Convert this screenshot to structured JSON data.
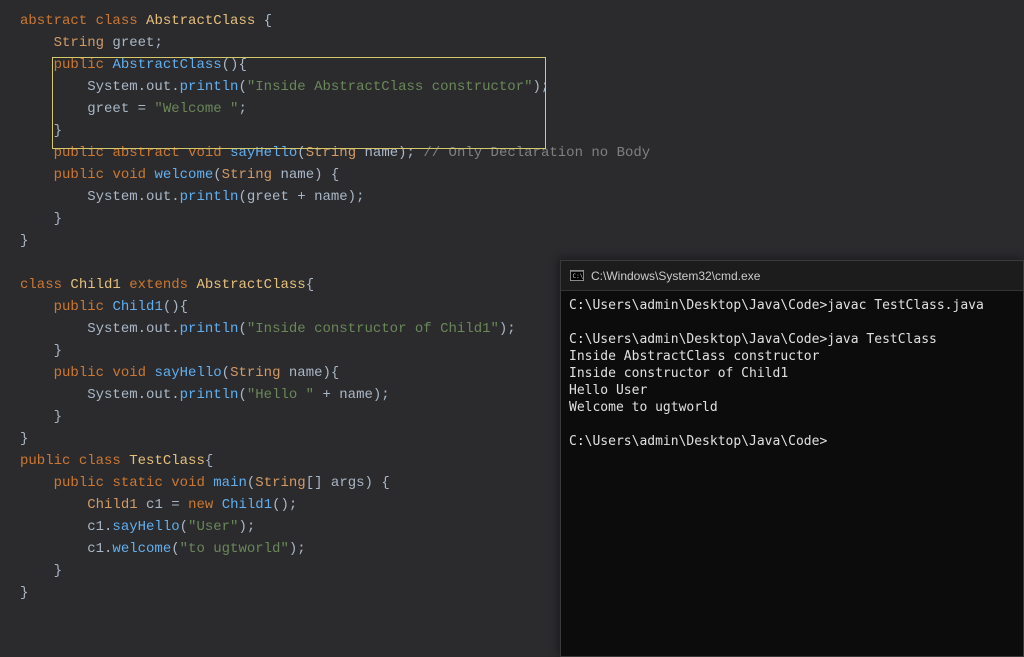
{
  "editor": {
    "tokens": [
      [
        {
          "t": "abstract",
          "c": "kw"
        },
        {
          "t": " ",
          "c": "punc"
        },
        {
          "t": "class",
          "c": "kw"
        },
        {
          "t": " ",
          "c": "punc"
        },
        {
          "t": "AbstractClass",
          "c": "cls"
        },
        {
          "t": " {",
          "c": "punc"
        }
      ],
      [
        {
          "t": "    ",
          "c": "punc"
        },
        {
          "t": "String",
          "c": "type"
        },
        {
          "t": " greet;",
          "c": "punc"
        }
      ],
      [
        {
          "t": "    ",
          "c": "punc"
        },
        {
          "t": "public",
          "c": "kw"
        },
        {
          "t": " ",
          "c": "punc"
        },
        {
          "t": "AbstractClass",
          "c": "fn"
        },
        {
          "t": "(){",
          "c": "punc"
        }
      ],
      [
        {
          "t": "        System.out.",
          "c": "punc"
        },
        {
          "t": "println",
          "c": "fn"
        },
        {
          "t": "(",
          "c": "punc"
        },
        {
          "t": "\"Inside AbstractClass constructor\"",
          "c": "str"
        },
        {
          "t": ");",
          "c": "punc"
        }
      ],
      [
        {
          "t": "        greet = ",
          "c": "punc"
        },
        {
          "t": "\"Welcome \"",
          "c": "str"
        },
        {
          "t": ";",
          "c": "punc"
        }
      ],
      [
        {
          "t": "    }",
          "c": "punc"
        }
      ],
      [
        {
          "t": "    ",
          "c": "punc"
        },
        {
          "t": "public",
          "c": "kw"
        },
        {
          "t": " ",
          "c": "punc"
        },
        {
          "t": "abstract",
          "c": "kw"
        },
        {
          "t": " ",
          "c": "punc"
        },
        {
          "t": "void",
          "c": "kw"
        },
        {
          "t": " ",
          "c": "punc"
        },
        {
          "t": "sayHello",
          "c": "fn"
        },
        {
          "t": "(",
          "c": "punc"
        },
        {
          "t": "String",
          "c": "type"
        },
        {
          "t": " name);",
          "c": "punc"
        },
        {
          "t": " ",
          "c": "punc"
        },
        {
          "t": "// Only Declaration no Body",
          "c": "cmt"
        }
      ],
      [
        {
          "t": "    ",
          "c": "punc"
        },
        {
          "t": "public",
          "c": "kw"
        },
        {
          "t": " ",
          "c": "punc"
        },
        {
          "t": "void",
          "c": "kw"
        },
        {
          "t": " ",
          "c": "punc"
        },
        {
          "t": "welcome",
          "c": "fn"
        },
        {
          "t": "(",
          "c": "punc"
        },
        {
          "t": "String",
          "c": "type"
        },
        {
          "t": " name) {",
          "c": "punc"
        }
      ],
      [
        {
          "t": "        System.out.",
          "c": "punc"
        },
        {
          "t": "println",
          "c": "fn"
        },
        {
          "t": "(greet + name);",
          "c": "punc"
        }
      ],
      [
        {
          "t": "    }",
          "c": "punc"
        }
      ],
      [
        {
          "t": "}",
          "c": "punc"
        }
      ],
      [
        {
          "t": " ",
          "c": "punc"
        }
      ],
      [
        {
          "t": "class",
          "c": "kw"
        },
        {
          "t": " ",
          "c": "punc"
        },
        {
          "t": "Child1",
          "c": "cls"
        },
        {
          "t": " ",
          "c": "punc"
        },
        {
          "t": "extends",
          "c": "kw"
        },
        {
          "t": " ",
          "c": "punc"
        },
        {
          "t": "AbstractClass",
          "c": "cls"
        },
        {
          "t": "{",
          "c": "punc"
        }
      ],
      [
        {
          "t": "    ",
          "c": "punc"
        },
        {
          "t": "public",
          "c": "kw"
        },
        {
          "t": " ",
          "c": "punc"
        },
        {
          "t": "Child1",
          "c": "fn"
        },
        {
          "t": "(){",
          "c": "punc"
        }
      ],
      [
        {
          "t": "        System.out.",
          "c": "punc"
        },
        {
          "t": "println",
          "c": "fn"
        },
        {
          "t": "(",
          "c": "punc"
        },
        {
          "t": "\"Inside constructor of Child1\"",
          "c": "str"
        },
        {
          "t": ");",
          "c": "punc"
        }
      ],
      [
        {
          "t": "    }",
          "c": "punc"
        }
      ],
      [
        {
          "t": "    ",
          "c": "punc"
        },
        {
          "t": "public",
          "c": "kw"
        },
        {
          "t": " ",
          "c": "punc"
        },
        {
          "t": "void",
          "c": "kw"
        },
        {
          "t": " ",
          "c": "punc"
        },
        {
          "t": "sayHello",
          "c": "fn"
        },
        {
          "t": "(",
          "c": "punc"
        },
        {
          "t": "String",
          "c": "type"
        },
        {
          "t": " name){",
          "c": "punc"
        }
      ],
      [
        {
          "t": "        System.out.",
          "c": "punc"
        },
        {
          "t": "println",
          "c": "fn"
        },
        {
          "t": "(",
          "c": "punc"
        },
        {
          "t": "\"Hello \"",
          "c": "str"
        },
        {
          "t": " + name);",
          "c": "punc"
        }
      ],
      [
        {
          "t": "    }",
          "c": "punc"
        }
      ],
      [
        {
          "t": "}",
          "c": "punc"
        }
      ],
      [
        {
          "t": "public",
          "c": "kw"
        },
        {
          "t": " ",
          "c": "punc"
        },
        {
          "t": "class",
          "c": "kw"
        },
        {
          "t": " ",
          "c": "punc"
        },
        {
          "t": "TestClass",
          "c": "cls"
        },
        {
          "t": "{",
          "c": "punc"
        }
      ],
      [
        {
          "t": "    ",
          "c": "punc"
        },
        {
          "t": "public",
          "c": "kw"
        },
        {
          "t": " ",
          "c": "punc"
        },
        {
          "t": "static",
          "c": "kw"
        },
        {
          "t": " ",
          "c": "punc"
        },
        {
          "t": "void",
          "c": "kw"
        },
        {
          "t": " ",
          "c": "punc"
        },
        {
          "t": "main",
          "c": "fn"
        },
        {
          "t": "(",
          "c": "punc"
        },
        {
          "t": "String",
          "c": "type"
        },
        {
          "t": "[] args) {",
          "c": "punc"
        }
      ],
      [
        {
          "t": "        ",
          "c": "punc"
        },
        {
          "t": "Child1",
          "c": "type"
        },
        {
          "t": " c1 = ",
          "c": "punc"
        },
        {
          "t": "new",
          "c": "kw"
        },
        {
          "t": " ",
          "c": "punc"
        },
        {
          "t": "Child1",
          "c": "fn"
        },
        {
          "t": "();",
          "c": "punc"
        }
      ],
      [
        {
          "t": "        c1.",
          "c": "punc"
        },
        {
          "t": "sayHello",
          "c": "fn"
        },
        {
          "t": "(",
          "c": "punc"
        },
        {
          "t": "\"User\"",
          "c": "str"
        },
        {
          "t": ");",
          "c": "punc"
        }
      ],
      [
        {
          "t": "        c1.",
          "c": "punc"
        },
        {
          "t": "welcome",
          "c": "fn"
        },
        {
          "t": "(",
          "c": "punc"
        },
        {
          "t": "\"to ugtworld\"",
          "c": "str"
        },
        {
          "t": ");",
          "c": "punc"
        }
      ],
      [
        {
          "t": "    }",
          "c": "punc"
        }
      ],
      [
        {
          "t": "}",
          "c": "punc"
        }
      ]
    ]
  },
  "terminal": {
    "title": "C:\\Windows\\System32\\cmd.exe",
    "lines": [
      "C:\\Users\\admin\\Desktop\\Java\\Code>javac TestClass.java",
      "",
      "C:\\Users\\admin\\Desktop\\Java\\Code>java TestClass",
      "Inside AbstractClass constructor",
      "Inside constructor of Child1",
      "Hello User",
      "Welcome to ugtworld",
      "",
      "C:\\Users\\admin\\Desktop\\Java\\Code>"
    ]
  }
}
